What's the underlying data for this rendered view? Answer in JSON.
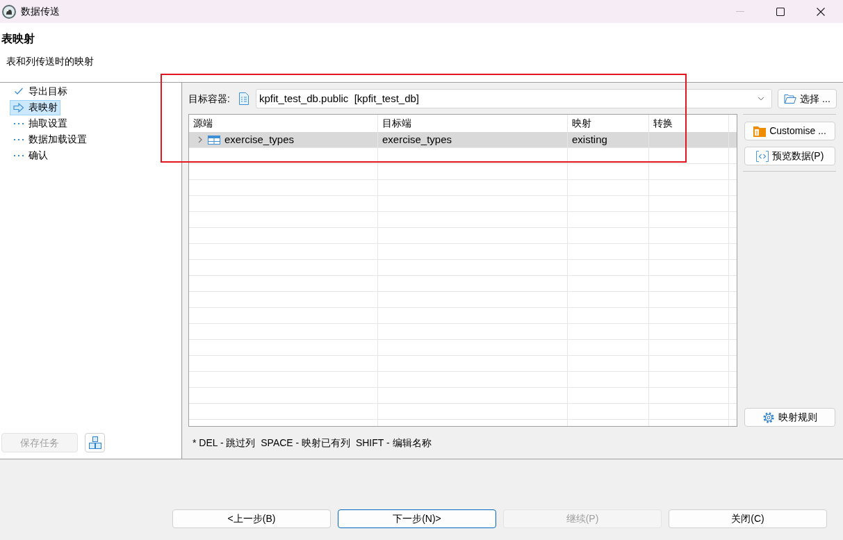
{
  "window": {
    "title": "数据传送",
    "controls": [
      {
        "kind": "minimize",
        "disabled": true
      },
      {
        "kind": "maximize",
        "disabled": false
      },
      {
        "kind": "close",
        "disabled": false
      }
    ]
  },
  "page": {
    "title": "表映射",
    "subtitle": "表和列传送时的映射"
  },
  "steps": [
    {
      "label": "导出目标",
      "kind": "done",
      "selected": false
    },
    {
      "label": "表映射",
      "kind": "current",
      "selected": true
    },
    {
      "label": "抽取设置",
      "kind": "pending",
      "selected": false
    },
    {
      "label": "数据加载设置",
      "kind": "pending",
      "selected": false
    },
    {
      "label": "确认",
      "kind": "pending",
      "selected": false
    }
  ],
  "save_task_button": {
    "label": "保存任务",
    "disabled": true
  },
  "target_container": {
    "label": "目标容器:",
    "value": "kpfit_test_db.public  [kpfit_test_db]"
  },
  "choose_button": {
    "label": "选择 ..."
  },
  "table": {
    "columns": [
      "源端",
      "目标端",
      "映射",
      "转换"
    ],
    "rows": [
      {
        "source": "exercise_types",
        "target": "exercise_types",
        "mapping": "existing",
        "selected": true,
        "expanded": false
      }
    ]
  },
  "customise_button": {
    "label": "Customise ..."
  },
  "preview_button": {
    "label": "预览数据(P)"
  },
  "rules_button": {
    "label": "映射规则"
  },
  "hint": "* DEL - 跳过列  SPACE - 映射已有列  SHIFT - 编辑名称",
  "buttons": [
    {
      "label": "<上一步(B)",
      "disabled": false,
      "focused": false
    },
    {
      "label": "下一步(N)>",
      "disabled": false,
      "focused": true
    },
    {
      "label": "继续(P)",
      "disabled": true,
      "focused": false
    },
    {
      "label": "关闭(C)",
      "disabled": false,
      "focused": false
    }
  ],
  "annotation": {
    "kind": "rectangle"
  }
}
